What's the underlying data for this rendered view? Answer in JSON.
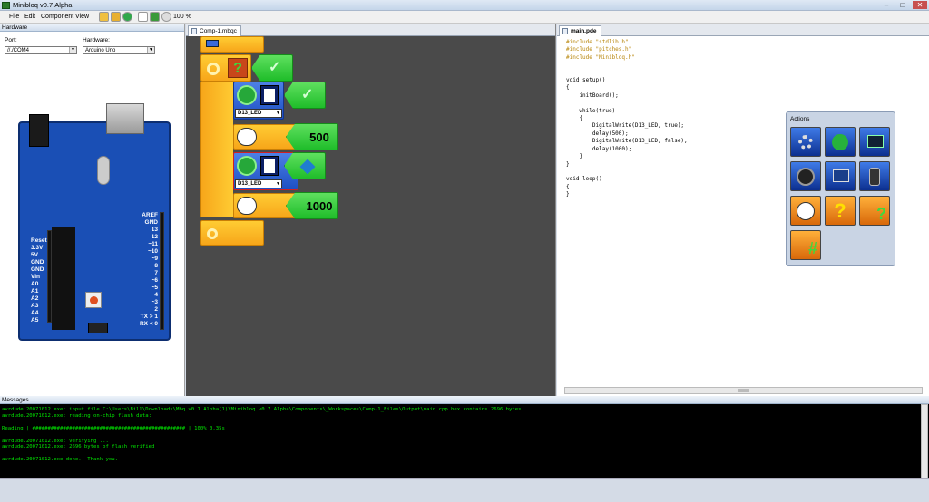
{
  "app": {
    "title": "Minibloq v0.7.Alpha",
    "window_buttons": [
      "–",
      "□",
      "✕"
    ]
  },
  "menu": [
    "File",
    "Edit",
    "Component",
    "View"
  ],
  "toolbar": {
    "zoom": "100 %"
  },
  "hardware": {
    "panel_title": "Hardware",
    "port_label": "Port:",
    "port_value": "//./COM4",
    "hardware_label": "Hardware:",
    "hardware_value": "Arduino Uno",
    "board_pins_left": [
      "Reset",
      "3.3V",
      "5V",
      "GND",
      "GND",
      "Vin",
      "",
      "A0",
      "A1",
      "A2",
      "A3",
      "A4",
      "A5"
    ],
    "board_pins_right": [
      "AREF",
      "GND",
      "13",
      "12",
      "~11",
      "~10",
      "~9",
      "8",
      "",
      "7",
      "~6",
      "~5",
      "4",
      "~3",
      "2",
      "TX > 1",
      "RX < 0"
    ]
  },
  "editor": {
    "tab": "Comp-1.mbqc",
    "blocks": {
      "led1": "D13_LED",
      "delay1": "500",
      "led2": "D13_LED",
      "delay2": "1000"
    }
  },
  "code": {
    "tab": "main.pde",
    "lines": [
      "#include \"stdlib.h\"",
      "#include \"pitches.h\"",
      "#include \"Minibloq.h\"",
      "",
      "",
      "void setup()",
      "{",
      "    initBoard();",
      "",
      "    while(true)",
      "    {",
      "        DigitalWrite(D13_LED, true);",
      "        delay(500);",
      "        DigitalWrite(D13_LED, false);",
      "        delay(1000);",
      "    }",
      "}",
      "",
      "void loop()",
      "{",
      "}"
    ]
  },
  "actions": {
    "title": "Actions"
  },
  "messages": {
    "title": "Messages",
    "lines": [
      "avrdude.20071012.exe: input file C:\\Users\\Bill\\Downloads\\Mbq.v0.7.Alpha(1)\\Minibloq.v0.7.Alpha\\Components\\_Workspaces\\Comp-1_Files\\Output\\main.cpp.hex contains 2696 bytes",
      "avrdude.20071012.exe: reading on-chip flash data:",
      "",
      "Reading | ################################################## | 100% 0.35s",
      "",
      "avrdude.20071012.exe: verifying ...",
      "avrdude.20071012.exe: 2696 bytes of flash verified",
      "",
      "avrdude.20071012.exe done.  Thank you."
    ]
  },
  "colors": {
    "block_orange": "#f7a61a",
    "block_blue": "#1d4fc2",
    "block_green": "#1fbd2a",
    "canvas": "#4a4a4a",
    "console_text": "#00e600"
  }
}
